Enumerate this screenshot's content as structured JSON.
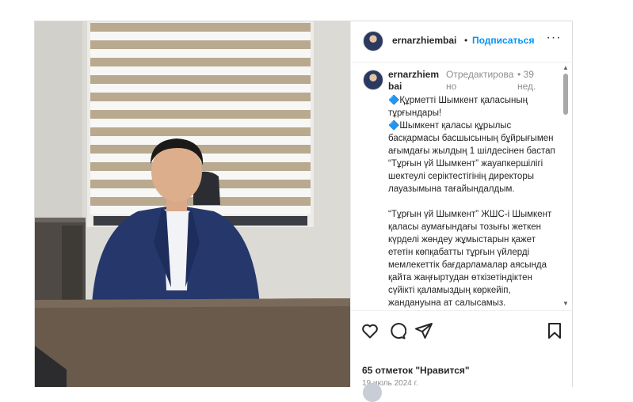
{
  "post": {
    "username": "ernarzhiembai",
    "separator": "•",
    "follow_label": "Подписаться",
    "more_label": "···",
    "caption": {
      "username": "ernarzhiembai",
      "edited_label": "Отредактировано",
      "time_separator": "•",
      "time": "39 нед.",
      "text": "🔷Құрметті Шымкент қаласының тұрғындары!\n🔷Шымкент қаласы құрылыс басқармасы басшысының бұйрығымен ағымдағы жылдың 1 шілдесінен бастап “Тұрғын үй Шымкент” жауапкершілігі шектеулі серіктестігінің директоры лауазымына тағайындалдым.\n\n“Тұрғын үй Шымкент” ЖШС-і Шымкент қаласы аумағындағы тозығы жеткен күрделі жөндеу жұмыстарын қажет ететін көпқабатты тұрғын үйлерді мемлекеттік бағдарламалар аясында қайта жаңғыртудан өткізетіндіктен сүйікті қаламыздың көркейіп, жандануына ат салысамыз."
    },
    "likes_text": "65 отметок \"Нравится\"",
    "date_text": "19 июль 2024 г.",
    "icons": {
      "like": "heart-icon",
      "comment": "comment-icon",
      "share": "share-icon",
      "save": "bookmark-icon",
      "more": "more-options-icon"
    },
    "colors": {
      "link": "#0095f6",
      "muted": "#8e8e8e",
      "text": "#262626",
      "border": "#dbdbdb"
    }
  }
}
